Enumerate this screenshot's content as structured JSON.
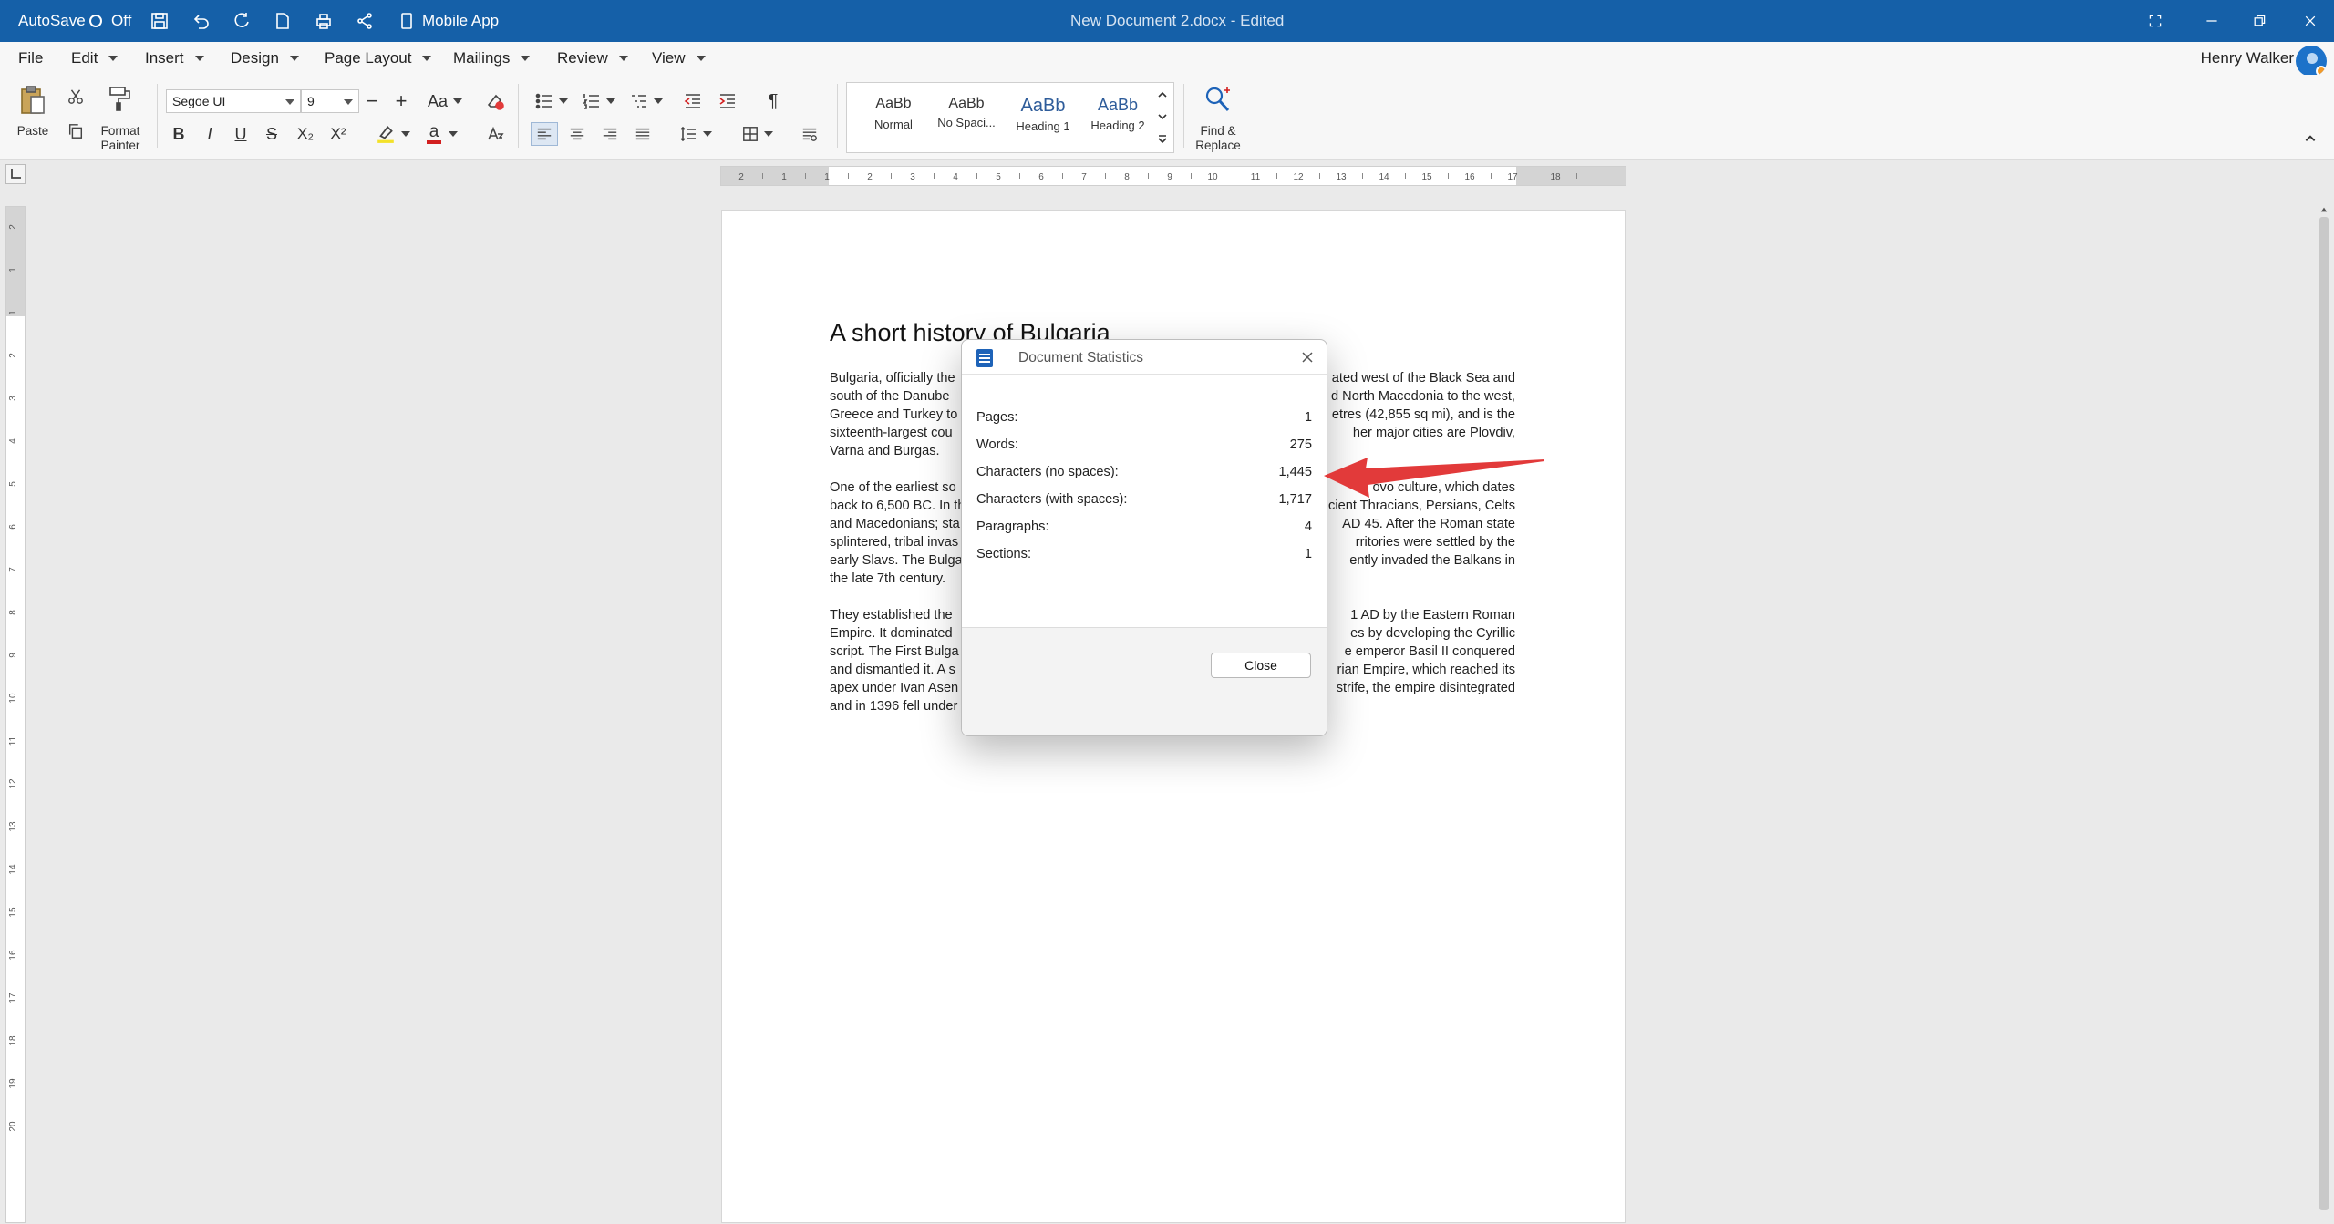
{
  "titlebar": {
    "autosave_label": "AutoSave",
    "autosave_state": "Off",
    "mobile_app": "Mobile App",
    "document_title": "New Document 2.docx - Edited"
  },
  "menu": {
    "items": [
      "File",
      "Edit",
      "Insert",
      "Design",
      "Page Layout",
      "Mailings",
      "Review",
      "View"
    ],
    "user_name": "Henry Walker"
  },
  "ribbon": {
    "paste": "Paste",
    "format_painter_1": "Format",
    "format_painter_2": "Painter",
    "font_name": "Segoe UI",
    "font_size": "9",
    "change_case": "Aa",
    "bold": "B",
    "italic": "I",
    "underline": "U",
    "strike": "S",
    "subscript": "X₂",
    "superscript": "X²",
    "font_color": "a",
    "pilcrow": "¶",
    "styles": [
      {
        "sample": "AaBb",
        "name": "Normal"
      },
      {
        "sample": "AaBb",
        "name": "No Spaci..."
      },
      {
        "sample": "AaBb",
        "name": "Heading 1"
      },
      {
        "sample": "AaBb",
        "name": "Heading 2"
      }
    ],
    "find_replace_1": "Find &",
    "find_replace_2": "Replace"
  },
  "ruler": {
    "h_ticks": [
      "2",
      "1",
      "1",
      "2",
      "3",
      "4",
      "5",
      "6",
      "7",
      "8",
      "9",
      "10",
      "11",
      "12",
      "13",
      "14",
      "15",
      "16",
      "17",
      "18"
    ],
    "v_ticks": [
      "2",
      "1",
      "1",
      "2",
      "3",
      "4",
      "5",
      "6",
      "7",
      "8",
      "9",
      "10",
      "11",
      "12",
      "13",
      "14",
      "15",
      "16",
      "17",
      "18",
      "19",
      "20"
    ]
  },
  "document": {
    "title": "A short history of Bulgaria",
    "paragraphs": [
      [
        "Bulgaria, officially the",
        "ated west of the Black Sea and",
        "south of the Danube",
        "d North Macedonia to the west,",
        "Greece and Turkey to",
        "etres (42,855 sq mi), and is the",
        "sixteenth-largest cou",
        "her major cities are Plovdiv,",
        "Varna and Burgas."
      ],
      [
        "One of the earliest so",
        "ovo culture, which dates",
        "back to 6,500 BC. In th",
        "cient Thracians, Persians, Celts",
        "and Macedonians; sta",
        "AD 45. After the Roman state",
        "splintered, tribal invas",
        "rritories were settled by the",
        "early Slavs. The Bulga",
        "ently invaded the Balkans in",
        "the late 7th century."
      ],
      [
        "They established the",
        "1 AD by the Eastern Roman",
        "Empire. It dominated",
        "es by developing the Cyrillic",
        "script. The First Bulga",
        "e emperor Basil II conquered",
        "and dismantled it. A s",
        "rian Empire, which reached its",
        "apex under Ivan Asen",
        "strife, the empire disintegrated",
        "and in 1396 fell under Ottoman rule for nearly five centuries."
      ]
    ]
  },
  "dialog": {
    "title": "Document Statistics",
    "stats": [
      {
        "label": "Pages:",
        "value": "1"
      },
      {
        "label": "Words:",
        "value": "275"
      },
      {
        "label": "Characters (no spaces):",
        "value": "1,445"
      },
      {
        "label": "Characters (with spaces):",
        "value": "1,717"
      },
      {
        "label": "Paragraphs:",
        "value": "4"
      },
      {
        "label": "Sections:",
        "value": "1"
      }
    ],
    "close_button": "Close"
  },
  "colors": {
    "titlebar": "#1560a8",
    "annotation_arrow": "#e23a3a"
  }
}
